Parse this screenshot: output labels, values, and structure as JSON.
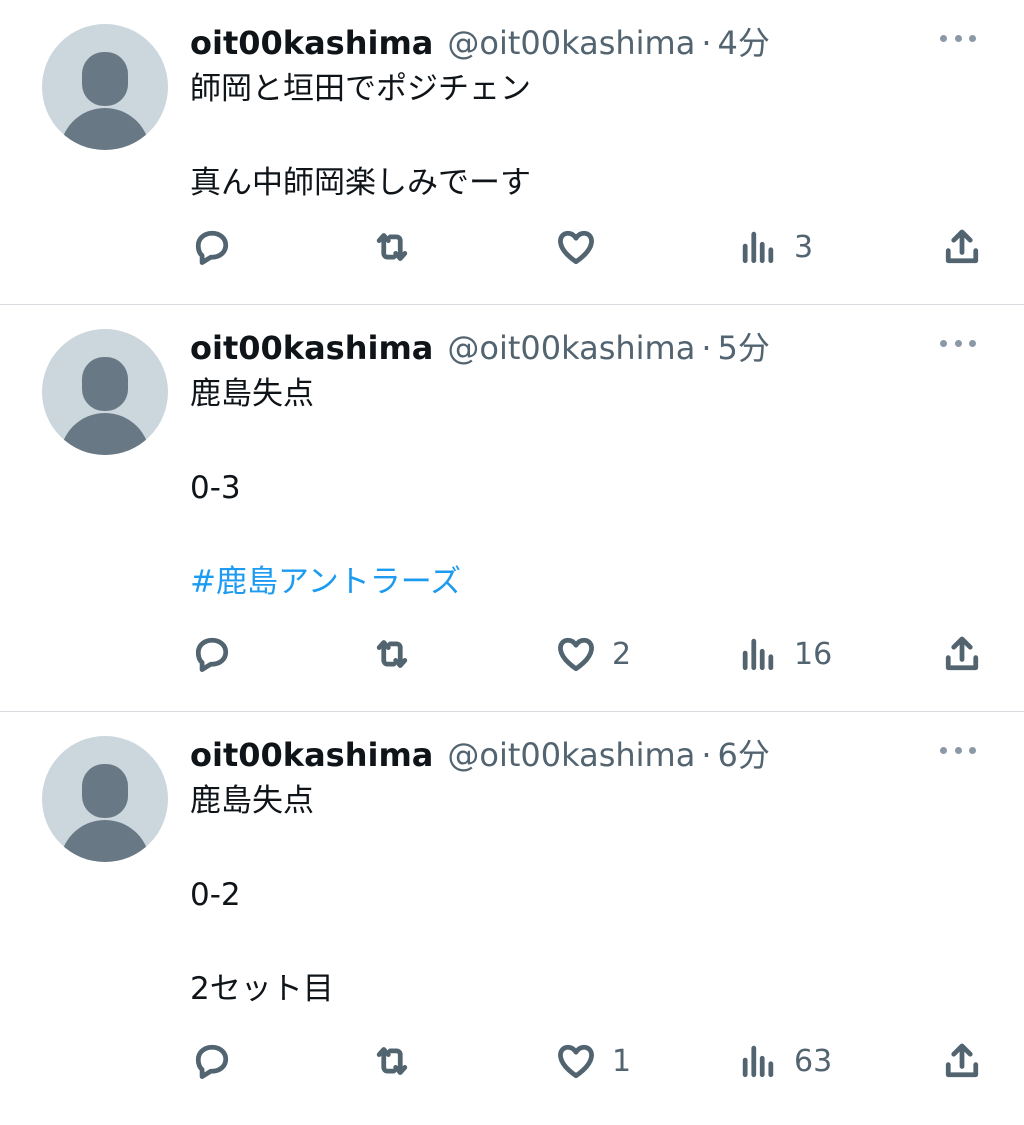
{
  "tweets": [
    {
      "name": "oit00kashima",
      "handle": "@oit00kashima",
      "separator": "·",
      "time": "4分",
      "lines": [
        "師岡と垣田でポジチェン",
        "",
        "真ん中師岡楽しみでーす"
      ],
      "hashtag": "",
      "reply_count": "",
      "retweet_count": "",
      "like_count": "",
      "view_count": "3"
    },
    {
      "name": "oit00kashima",
      "handle": "@oit00kashima",
      "separator": "·",
      "time": "5分",
      "lines": [
        "鹿島失点",
        "",
        "0-3",
        ""
      ],
      "hashtag": "#鹿島アントラーズ",
      "reply_count": "",
      "retweet_count": "",
      "like_count": "2",
      "view_count": "16"
    },
    {
      "name": "oit00kashima",
      "handle": "@oit00kashima",
      "separator": "·",
      "time": "6分",
      "lines": [
        "鹿島失点",
        "",
        "0-2",
        "",
        "2セット目"
      ],
      "hashtag": "",
      "reply_count": "",
      "retweet_count": "",
      "like_count": "1",
      "view_count": "63"
    }
  ],
  "icons": {
    "reply": "reply-icon",
    "retweet": "retweet-icon",
    "like": "heart-icon",
    "views": "views-icon",
    "share": "share-icon",
    "more": "more-icon",
    "avatar": "default-avatar-icon"
  },
  "colors": {
    "text": "#0f1419",
    "secondary": "#536471",
    "link": "#1d9bf0",
    "avatar_bg": "#ccd6dd",
    "avatar_fg": "#687885",
    "divider": "#d9dde1"
  }
}
